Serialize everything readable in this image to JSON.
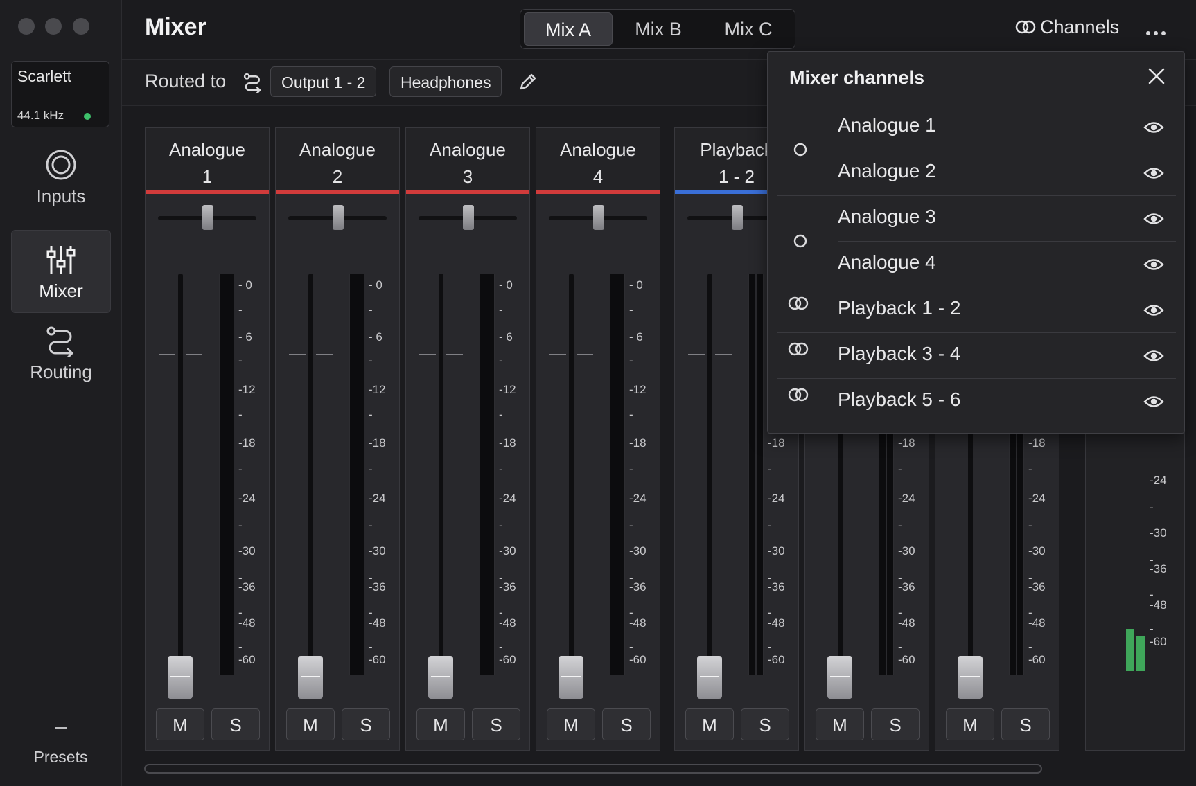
{
  "app": {
    "title": "Mixer"
  },
  "device": {
    "name": "Scarlett",
    "rate": "44.1 kHz",
    "status_color": "#3ec16b"
  },
  "nav": [
    {
      "label": "Inputs",
      "icon": "inputs-icon"
    },
    {
      "label": "Mixer",
      "icon": "mixer-icon",
      "active": true
    },
    {
      "label": "Routing",
      "icon": "routing-icon"
    }
  ],
  "presets": {
    "label": "Presets"
  },
  "mix_tabs": [
    "Mix A",
    "Mix B",
    "Mix C"
  ],
  "header": {
    "channels_label": "Channels"
  },
  "routing": {
    "label": "Routed to",
    "outputs": [
      "Output 1 - 2",
      "Headphones"
    ]
  },
  "strips": [
    {
      "line1": "Analogue",
      "line2": "1",
      "color": "#d13b3b"
    },
    {
      "line1": "Analogue",
      "line2": "2",
      "color": "#d13b3b"
    },
    {
      "line1": "Analogue",
      "line2": "3",
      "color": "#d13b3b"
    },
    {
      "line1": "Analogue",
      "line2": "4",
      "color": "#d13b3b"
    },
    {
      "line1": "Playback",
      "line2": "1 - 2",
      "color": "#3a6fd8"
    },
    {
      "line1": "",
      "line2": "",
      "color": "#3a6fd8"
    },
    {
      "line1": "",
      "line2": "",
      "color": "#3a6fd8"
    }
  ],
  "meter_scale": [
    "0",
    "-",
    "6",
    "-",
    "-12",
    "-",
    "-18",
    "-",
    "-24",
    "-",
    "-30",
    "-",
    "-36",
    "-",
    "-48",
    "-",
    "-60"
  ],
  "strip_buttons": {
    "mute": "M",
    "solo": "S"
  },
  "popover": {
    "title": "Mixer channels",
    "channels": [
      "Analogue 1",
      "Analogue 2",
      "Analogue 3",
      "Analogue 4",
      "Playback 1 - 2",
      "Playback 3 - 4",
      "Playback 5 - 6"
    ]
  },
  "master_meter": {
    "level_color": "#3fa65a"
  }
}
